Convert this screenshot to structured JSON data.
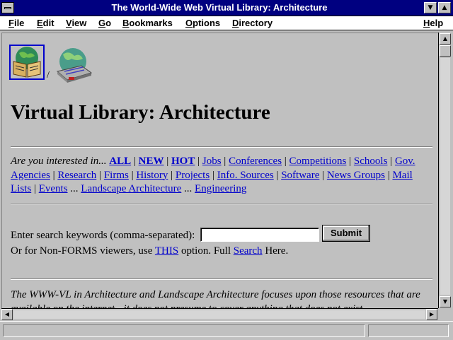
{
  "window": {
    "title": "The World-Wide Web Virtual Library: Architecture",
    "minimize_glyph": "▼",
    "maximize_glyph": "▲"
  },
  "menu": [
    {
      "first": "F",
      "rest": "ile"
    },
    {
      "first": "E",
      "rest": "dit"
    },
    {
      "first": "V",
      "rest": "iew"
    },
    {
      "first": "G",
      "rest": "o"
    },
    {
      "first": "B",
      "rest": "ookmarks"
    },
    {
      "first": "O",
      "rest": "ptions"
    },
    {
      "first": "D",
      "rest": "irectory"
    },
    {
      "first": "H",
      "rest": "elp"
    }
  ],
  "page": {
    "slash": "/",
    "heading": "Virtual Library: Architecture",
    "intro": "Are you interested in...",
    "links": {
      "all": "ALL",
      "new": "NEW",
      "hot": "HOT",
      "jobs": "Jobs",
      "conferences": "Conferences",
      "competitions": "Competitions",
      "schools": "Schools",
      "gov_agencies": "Gov. Agencies",
      "research": "Research",
      "firms": "Firms",
      "history": "History",
      "projects": "Projects",
      "info_sources": "Info. Sources",
      "software": "Software",
      "news_groups": "News Groups",
      "mail_lists": "Mail Lists",
      "events": "Events",
      "landscape": "Landscape Architecture",
      "engineering": "Engineering"
    },
    "search_label": "Enter search keywords (comma-separated):",
    "search_value": "",
    "submit_label": "Submit",
    "nonforms_prefix": "Or for Non-FORMS viewers, use",
    "nonforms_this": "THIS",
    "nonforms_mid": "option. Full",
    "nonforms_search": "Search",
    "nonforms_suffix": "Here.",
    "description": "The WWW-VL in Architecture and Landscape Architecture focuses upon those resources that are available on the internet - it does not presume to cover anything that does not exist"
  },
  "icons": {
    "book": "book-icon",
    "globe": "globe-icon"
  },
  "scroll": {
    "up": "▲",
    "down": "▼",
    "left": "◀",
    "right": "▶"
  }
}
